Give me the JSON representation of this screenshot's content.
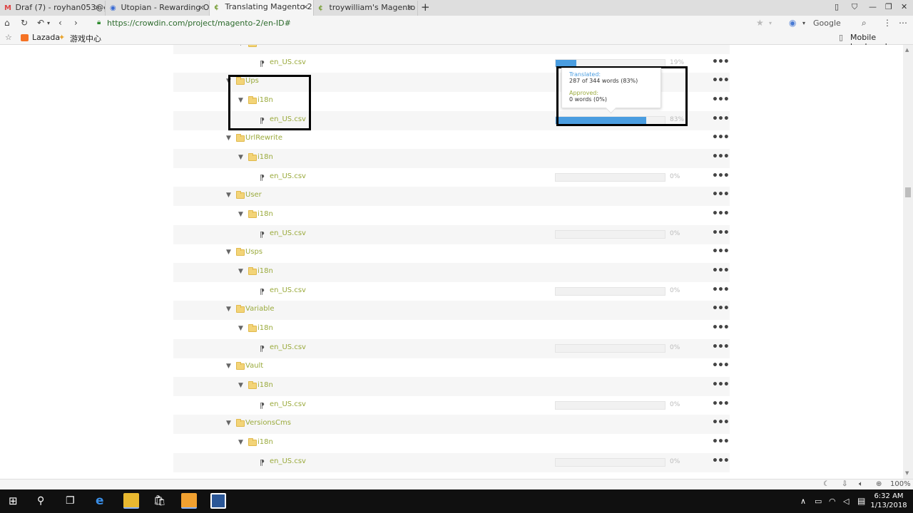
{
  "tabs": [
    {
      "label": "Draf (7) - royhan053@g",
      "icon": "gmail-icon",
      "active": false
    },
    {
      "label": "Utopian - Rewarding O",
      "icon": "utopian-icon",
      "active": false
    },
    {
      "label": "Translating Magento 2 t",
      "icon": "crowdin-icon",
      "active": true
    },
    {
      "label": "troywilliam's Magento 2",
      "icon": "crowdin-icon",
      "active": false
    }
  ],
  "address": {
    "url": "https://crowdin.com/project/magento-2/en-ID#",
    "search_engine": "Google"
  },
  "bookmarks": {
    "items": [
      "Lazada",
      "游戏中心"
    ],
    "mobile": "Mobile bookmarks"
  },
  "tree": {
    "rows": [
      {
        "type": "folder",
        "name": "i18n",
        "level": 1
      },
      {
        "type": "file",
        "name": "en_US.csv",
        "progress": 19,
        "pct_label": "19%"
      },
      {
        "type": "folder",
        "name": "Ups",
        "level": 0
      },
      {
        "type": "folder",
        "name": "i18n",
        "level": 1
      },
      {
        "type": "file",
        "name": "en_US.csv",
        "progress": 83,
        "pct_label": "83%"
      },
      {
        "type": "folder",
        "name": "UrlRewrite",
        "level": 0
      },
      {
        "type": "folder",
        "name": "i18n",
        "level": 1
      },
      {
        "type": "file",
        "name": "en_US.csv",
        "progress": 0,
        "pct_label": "0%"
      },
      {
        "type": "folder",
        "name": "User",
        "level": 0
      },
      {
        "type": "folder",
        "name": "i18n",
        "level": 1
      },
      {
        "type": "file",
        "name": "en_US.csv",
        "progress": 0,
        "pct_label": "0%"
      },
      {
        "type": "folder",
        "name": "Usps",
        "level": 0
      },
      {
        "type": "folder",
        "name": "i18n",
        "level": 1
      },
      {
        "type": "file",
        "name": "en_US.csv",
        "progress": 0,
        "pct_label": "0%"
      },
      {
        "type": "folder",
        "name": "Variable",
        "level": 0
      },
      {
        "type": "folder",
        "name": "i18n",
        "level": 1
      },
      {
        "type": "file",
        "name": "en_US.csv",
        "progress": 0,
        "pct_label": "0%"
      },
      {
        "type": "folder",
        "name": "Vault",
        "level": 0
      },
      {
        "type": "folder",
        "name": "i18n",
        "level": 1
      },
      {
        "type": "file",
        "name": "en_US.csv",
        "progress": 0,
        "pct_label": "0%"
      },
      {
        "type": "folder",
        "name": "VersionsCms",
        "level": 0
      },
      {
        "type": "folder",
        "name": "i18n",
        "level": 1
      },
      {
        "type": "file",
        "name": "en_US.csv",
        "progress": 0,
        "pct_label": "0%"
      }
    ]
  },
  "tooltip": {
    "translated_label": "Translated:",
    "translated_value": "287 of 344 words (83%)",
    "approved_label": "Approved:",
    "approved_value": "0 words (0%)"
  },
  "status": {
    "zoom": "100%"
  },
  "clock": {
    "time": "6:32 AM",
    "date": "1/13/2018"
  },
  "colors": {
    "accent": "#4a9de0",
    "folder_name": "#9aaa3c"
  }
}
